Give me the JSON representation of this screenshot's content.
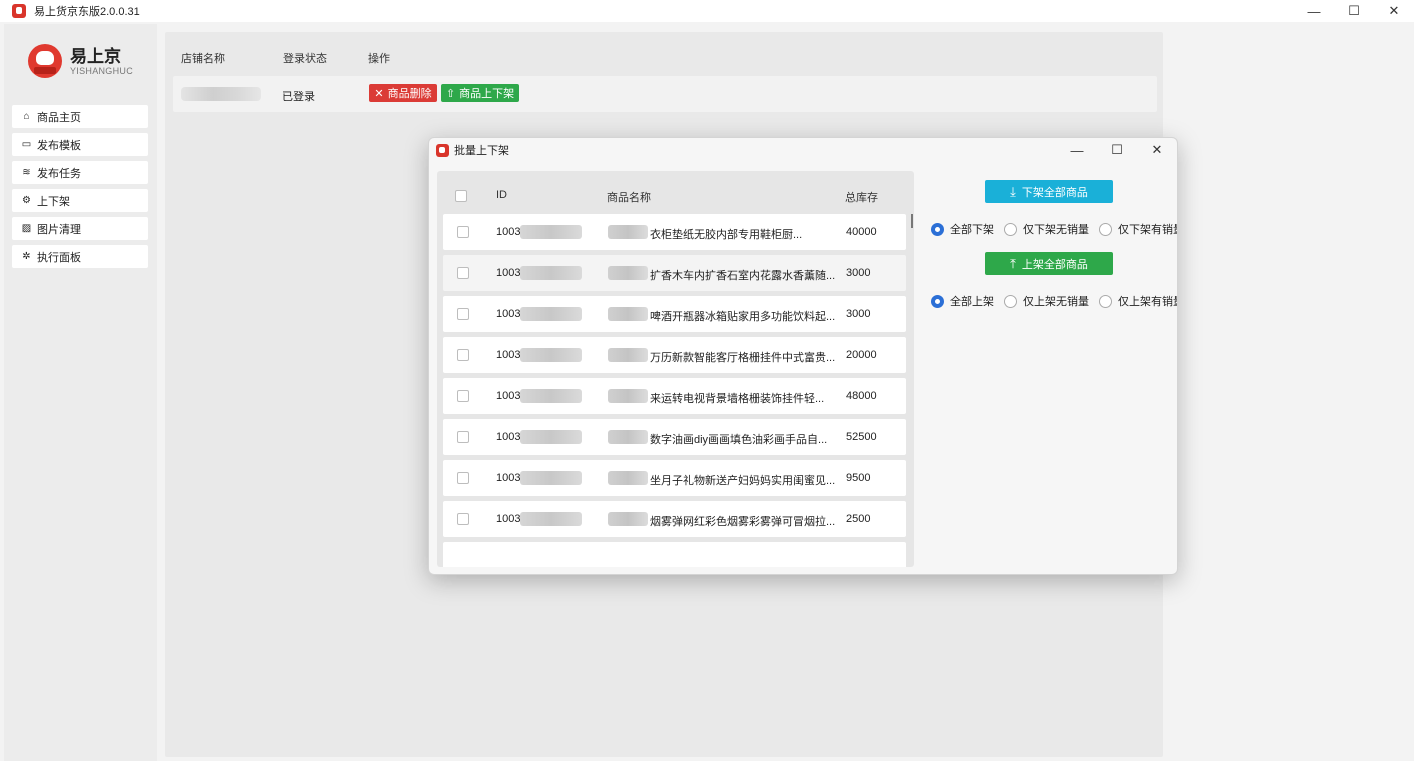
{
  "window": {
    "title": "易上货京东版2.0.0.31",
    "min": "—",
    "max": "☐",
    "close": "✕"
  },
  "logo": {
    "name": "易上京",
    "subtitle": "YISHANGHUC"
  },
  "sidebar": {
    "items": [
      {
        "label": "商品主页",
        "icon": "home-icon",
        "glyph": "⌂"
      },
      {
        "label": "发布模板",
        "icon": "calendar-icon",
        "glyph": "▭"
      },
      {
        "label": "发布任务",
        "icon": "tasks-icon",
        "glyph": "≋"
      },
      {
        "label": "上下架",
        "icon": "gears-icon",
        "glyph": "⚙"
      },
      {
        "label": "图片清理",
        "icon": "image-icon",
        "glyph": "▨"
      },
      {
        "label": "执行面板",
        "icon": "gear-icon",
        "glyph": "✲"
      }
    ]
  },
  "shops_table": {
    "headers": {
      "name": "店铺名称",
      "status": "登录状态",
      "action": "操作"
    },
    "row": {
      "status": "已登录",
      "delete_label": "商品删除",
      "shelf_label": "商品上下架"
    }
  },
  "dialog": {
    "title": "批量上下架",
    "min": "—",
    "max": "☐",
    "close": "✕",
    "grid": {
      "headers": {
        "id": "ID",
        "name": "商品名称",
        "stock": "总库存"
      },
      "rows": [
        {
          "id": "1003",
          "name": "衣柜垫纸无胶内部专用鞋柜厨...",
          "stock": "40000"
        },
        {
          "id": "1003",
          "name": "扩香木车内扩香石室内花露水香薰随...",
          "stock": "3000"
        },
        {
          "id": "1003",
          "name": "啤酒开瓶器冰箱贴家用多功能饮料起...",
          "stock": "3000"
        },
        {
          "id": "1003",
          "name": "万历新款智能客厅格栅挂件中式富贵...",
          "stock": "20000"
        },
        {
          "id": "1003",
          "name": "来运转电视背景墙格栅装饰挂件轻...",
          "stock": "48000"
        },
        {
          "id": "1003",
          "name": "数字油画diy画画填色油彩画手品自...",
          "stock": "52500"
        },
        {
          "id": "1003",
          "name": "坐月子礼物新送产妇妈妈实用闺蜜见...",
          "stock": "9500"
        },
        {
          "id": "1003",
          "name": "烟雾弹网红彩色烟雾彩雾弹可冒烟拉...",
          "stock": "2500"
        }
      ]
    },
    "unshelf": {
      "button": "下架全部商品",
      "color": "#1ab0d8",
      "options": [
        "全部下架",
        "仅下架无销量",
        "仅下架有销量"
      ]
    },
    "shelf": {
      "button": "上架全部商品",
      "color": "#2ea84a",
      "options": [
        "全部上架",
        "仅上架无销量",
        "仅上架有销量"
      ]
    }
  }
}
